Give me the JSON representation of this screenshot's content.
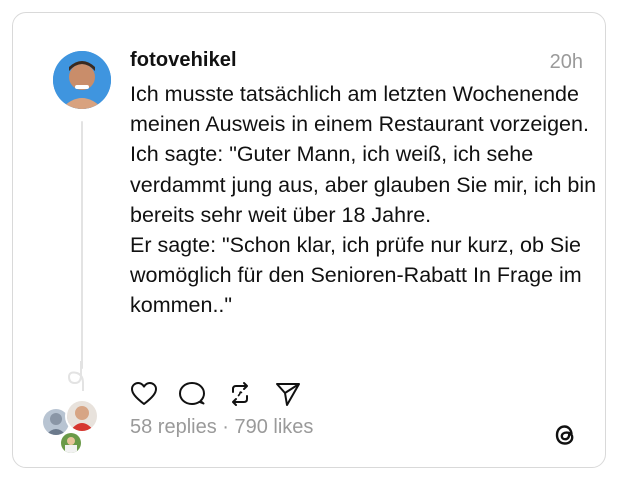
{
  "post": {
    "username": "fotovehikel",
    "timestamp": "20h",
    "paragraph1": "Ich musste tatsächlich am letzten Wochenende meinen Ausweis in einem Restaurant vorzeigen. Ich sagte: \"Guter Mann, ich weiß, ich sehe verdammt jung aus, aber glauben Sie mir, ich bin bereits sehr weit über 18 Jahre.",
    "paragraph2": "Er sagte: \"Schon klar, ich prüfe nur kurz, ob Sie womöglich für den Senioren-Rabatt In Frage im kommen..\""
  },
  "actions": {
    "icons": [
      "heart-icon",
      "comment-icon",
      "repost-icon",
      "share-icon"
    ]
  },
  "stats": {
    "text": "58 replies · 790 likes"
  },
  "brand": {
    "icon": "threads-logo-icon"
  },
  "colors": {
    "text": "#111111",
    "muted": "#9a9a9a",
    "border": "#d9d9d9"
  }
}
